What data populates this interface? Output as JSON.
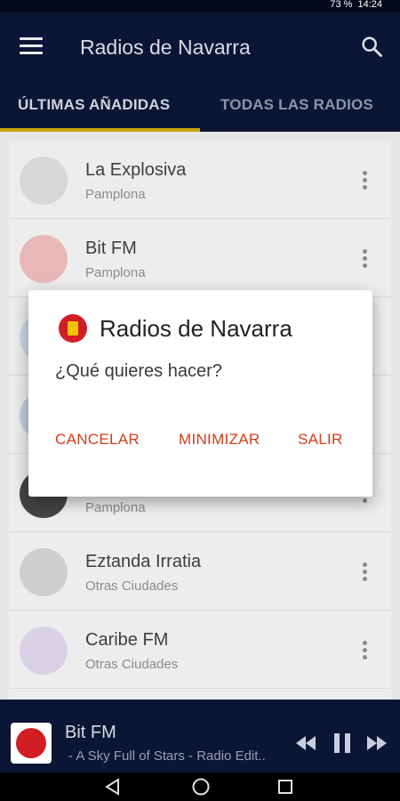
{
  "status_bar": {
    "battery_percent": "73 %",
    "time": "14:24"
  },
  "app_bar": {
    "title": "Radios de Navarra",
    "menu_icon": "menu-icon",
    "search_icon": "search-icon"
  },
  "tabs": [
    {
      "label": "ÚLTIMAS AÑADIDAS",
      "selected": true
    },
    {
      "label": "TODAS LAS RADIOS",
      "selected": false
    }
  ],
  "list": [
    {
      "name": "La Explosiva",
      "city": "Pamplona"
    },
    {
      "name": "Bit FM",
      "city": "Pamplona"
    },
    {
      "name": "",
      "city": ""
    },
    {
      "name": "",
      "city": ""
    },
    {
      "name": "",
      "city": "Pamplona"
    },
    {
      "name": "Eztanda Irratia",
      "city": "Otras Ciudades"
    },
    {
      "name": "Caribe FM",
      "city": "Otras Ciudades"
    }
  ],
  "dialog": {
    "title": "Radios de Navarra",
    "message": "¿Qué quieres hacer?",
    "buttons": {
      "cancel": "CANCELAR",
      "minimize": "MINIMIZAR",
      "exit": "SALIR"
    }
  },
  "player": {
    "title": "Bit FM",
    "subtitle": "- A Sky Full of Stars - Radio Edit..",
    "controls": [
      "previous-icon",
      "pause-icon",
      "next-icon"
    ]
  },
  "colors": {
    "appbar": "#0b1535",
    "tab_indicator": "#c7a40a",
    "dialog_button": "#d23c1a"
  }
}
